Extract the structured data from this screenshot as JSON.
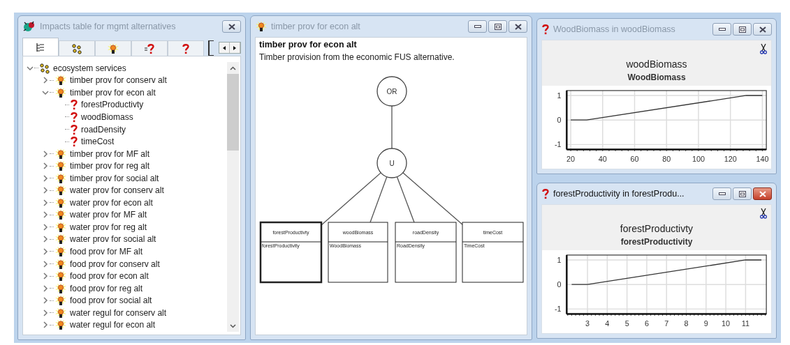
{
  "impacts_window": {
    "title": "Impacts table for mgmt alternatives",
    "kind": "bug",
    "active": false,
    "controls": [
      {
        "kind": "close"
      }
    ],
    "tabs": [
      {
        "kind": "tree",
        "selected": true
      },
      {
        "kind": "cluster",
        "selected": false
      },
      {
        "kind": "lamp",
        "selected": false
      },
      {
        "kind": "data-list",
        "selected": false
      },
      {
        "kind": "data",
        "selected": false
      }
    ],
    "tree": [
      {
        "label": "ecosystem services",
        "kind": "cluster",
        "expanded": true,
        "children": [
          {
            "label": "timber prov for conserv alt",
            "kind": "lamp",
            "expanded": false
          },
          {
            "label": "timber prov for econ alt",
            "kind": "lamp",
            "expanded": true,
            "children": [
              {
                "label": "forestProductivty",
                "kind": "data"
              },
              {
                "label": "woodBiomass",
                "kind": "data"
              },
              {
                "label": "roadDensity",
                "kind": "data"
              },
              {
                "label": "timeCost",
                "kind": "data"
              }
            ]
          },
          {
            "label": "timber prov for MF alt",
            "kind": "lamp",
            "expanded": false
          },
          {
            "label": "timber prov for reg alt",
            "kind": "lamp",
            "expanded": false
          },
          {
            "label": "timber prov for social alt",
            "kind": "lamp",
            "expanded": false
          },
          {
            "label": "water prov for conserv alt",
            "kind": "lamp",
            "expanded": false
          },
          {
            "label": "water prov for econ alt",
            "kind": "lamp",
            "expanded": false
          },
          {
            "label": "water prov for MF alt",
            "kind": "lamp",
            "expanded": false
          },
          {
            "label": "water prov for reg alt",
            "kind": "lamp",
            "expanded": false
          },
          {
            "label": "water prov for social alt",
            "kind": "lamp",
            "expanded": false
          },
          {
            "label": "food prov for MF alt",
            "kind": "lamp",
            "expanded": false
          },
          {
            "label": "food prov for conserv alt",
            "kind": "lamp",
            "expanded": false
          },
          {
            "label": "food prov for econ alt",
            "kind": "lamp",
            "expanded": false
          },
          {
            "label": "food prov for reg alt",
            "kind": "lamp",
            "expanded": false
          },
          {
            "label": "food prov for social alt",
            "kind": "lamp",
            "expanded": false
          },
          {
            "label": "water regul for conserv alt",
            "kind": "lamp",
            "expanded": false
          },
          {
            "label": "water regul for econ alt",
            "kind": "lamp",
            "expanded": false
          }
        ]
      }
    ]
  },
  "node_window": {
    "title": "timber prov for econ alt",
    "kind": "lamp",
    "active": false,
    "controls": [
      {
        "kind": "minimize"
      },
      {
        "kind": "maximize"
      },
      {
        "kind": "close"
      }
    ],
    "heading": "timber prov for econ alt",
    "description": "Timber provision from the economic FUS alternative.",
    "operators": [
      {
        "label": "OR"
      },
      {
        "label": "U"
      }
    ],
    "inputs": [
      {
        "title": "forestProductivty",
        "variable": "forestProductivity",
        "selected": true
      },
      {
        "title": "woodBiomass",
        "variable": "WoodBiomass",
        "selected": false
      },
      {
        "title": "roadDensity",
        "variable": "RoadDensity",
        "selected": false
      },
      {
        "title": "timeCost",
        "variable": "TimeCost",
        "selected": false
      }
    ]
  },
  "chart_windows": [
    {
      "title": "WoodBiomass in woodBiomass",
      "kind": "data",
      "active": false,
      "controls": [
        {
          "kind": "minimize"
        },
        {
          "kind": "maximize"
        },
        {
          "kind": "close"
        }
      ],
      "chart_data": {
        "type": "line",
        "grid": true,
        "title": "woodBiomass",
        "x": [
          20,
          30,
          130,
          140
        ],
        "xlim": [
          17.5,
          142.5
        ],
        "ylim": [
          -1.2,
          1.2
        ],
        "xticks": [
          20,
          40,
          60,
          80,
          100,
          120,
          140
        ],
        "yticks": [
          -1,
          0,
          1
        ],
        "series": [
          {
            "name": "WoodBiomass",
            "color": "#333333",
            "values": [
              0,
              0,
              1,
              1
            ]
          }
        ]
      }
    },
    {
      "title": "forestProductivity in forestProdu...",
      "kind": "data",
      "active": true,
      "controls": [
        {
          "kind": "minimize"
        },
        {
          "kind": "maximize"
        },
        {
          "kind": "close"
        }
      ],
      "chart_data": {
        "type": "line",
        "grid": true,
        "title": "forestProductivty",
        "x": [
          2.2,
          3,
          11,
          11.8
        ],
        "xlim": [
          1.95,
          12.05
        ],
        "ylim": [
          -1.2,
          1.2
        ],
        "xticks": [
          3,
          4,
          5,
          6,
          7,
          8,
          9,
          10,
          11
        ],
        "yticks": [
          -1,
          0,
          1
        ],
        "series": [
          {
            "name": "forestProductivity",
            "color": "#333333",
            "values": [
              0,
              0,
              1,
              1
            ]
          }
        ]
      }
    }
  ]
}
